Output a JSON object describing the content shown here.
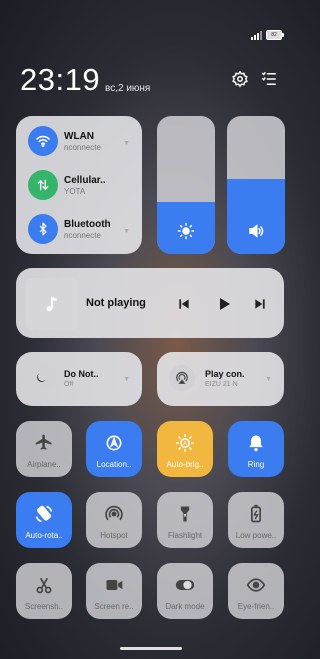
{
  "status_bar": {
    "battery": "82"
  },
  "header": {
    "time": "23:19",
    "date": "вс,2 июня"
  },
  "network": [
    {
      "label": "WLAN",
      "sub": "nconnecte",
      "color": "#3b7cf0"
    },
    {
      "label": "Cellular..",
      "sub": "YOTA",
      "color": "#34b56a"
    },
    {
      "label": "Bluetooth",
      "sub": "nconnecte",
      "color": "#3b7cf0"
    }
  ],
  "sliders": {
    "brightness_level": 0.38,
    "volume_level": 0.54
  },
  "media": {
    "title": "Not playing"
  },
  "dnd": {
    "title": "Do Not..",
    "sub": "Off"
  },
  "playcon": {
    "title": "Play con..",
    "sub": "EIZU 21 N"
  },
  "toggles": [
    {
      "label": "Airplane..",
      "icon": "airplane-icon",
      "state": "off"
    },
    {
      "label": "Location..",
      "icon": "location-icon",
      "state": "on"
    },
    {
      "label": "Auto-brig..",
      "icon": "auto-brightness-icon",
      "state": "yellow"
    },
    {
      "label": "Ring",
      "icon": "bell-icon",
      "state": "on"
    },
    {
      "label": "Auto-rota..",
      "icon": "rotate-icon",
      "state": "on"
    },
    {
      "label": "Hotspot",
      "icon": "hotspot-icon",
      "state": "off"
    },
    {
      "label": "Flashlight",
      "icon": "flashlight-icon",
      "state": "off"
    },
    {
      "label": "Low powe..",
      "icon": "battery-saver-icon",
      "state": "off"
    },
    {
      "label": "Screensh..",
      "icon": "scissors-icon",
      "state": "off"
    },
    {
      "label": "Screen re..",
      "icon": "video-camera-icon",
      "state": "off"
    },
    {
      "label": "Dark mode",
      "icon": "dark-mode-icon",
      "state": "off"
    },
    {
      "label": "Eye-frien..",
      "icon": "eye-icon",
      "state": "off"
    }
  ]
}
